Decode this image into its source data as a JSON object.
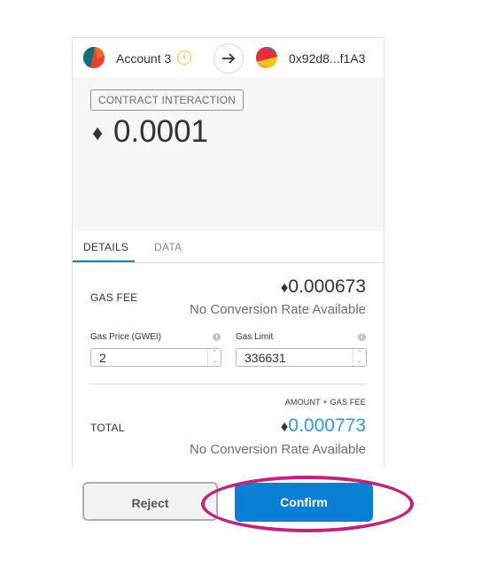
{
  "account_bar": {
    "from_name": "Account 3",
    "to_address": "0x92d8...f1A3",
    "info_glyph": "i",
    "arrow_glyph": "→"
  },
  "hero": {
    "badge": "CONTRACT INTERACTION",
    "eth_glyph": "♦",
    "amount": "0.0001"
  },
  "tabs": [
    {
      "label": "DETAILS",
      "active": true
    },
    {
      "label": "DATA",
      "active": false
    }
  ],
  "details": {
    "gas_fee_label": "GAS FEE",
    "gas_fee_value": "0.000673",
    "gas_fee_conversion": "No Conversion Rate Available",
    "gas_price_label": "Gas Price (GWEI)",
    "gas_price_value": "2",
    "gas_limit_label": "Gas Limit",
    "gas_limit_value": "336631",
    "amount_gas_fee_label": "AMOUNT + GAS FEE",
    "total_label": "TOTAL",
    "total_value": "0.000773",
    "total_conversion": "No Conversion Rate Available"
  },
  "buttons": {
    "reject": "Reject",
    "confirm": "Confirm"
  },
  "colors": {
    "accent_blue": "#0a7fd6",
    "total_blue": "#2f9ae0",
    "highlight": "#c2237a",
    "warning_yellow": "#f0c23c"
  }
}
